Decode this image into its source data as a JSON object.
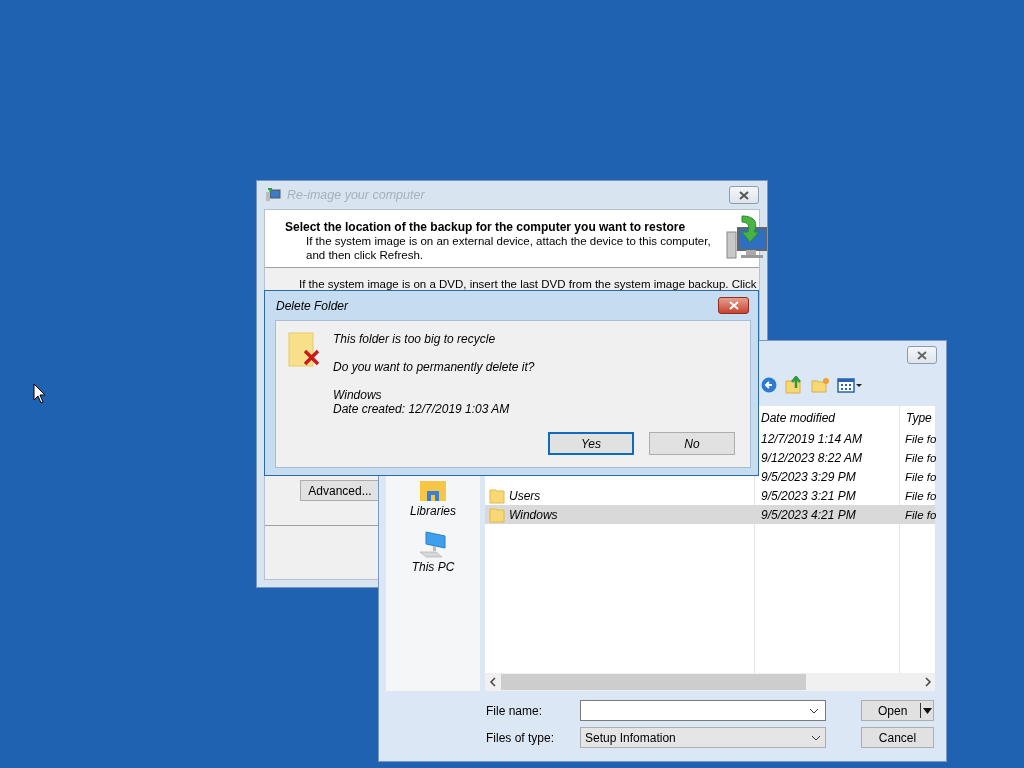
{
  "reimage_window": {
    "title": "Re-image your computer",
    "heading": "Select the location of the backup for the computer you want to restore",
    "subtext": "If the system image is on an external device, attach the device to this computer, and then click Refresh.",
    "body_text": "If the system image is on a DVD, insert the last DVD from the system image backup. Click",
    "advanced_button": "Advanced..."
  },
  "open_dialog": {
    "nav_items": [
      {
        "label": "Libraries",
        "kind": "libraries"
      },
      {
        "label": "This PC",
        "kind": "pc"
      }
    ],
    "columns": [
      "Date modified",
      "Type"
    ],
    "rows": [
      {
        "date": "12/7/2019 1:14 AM",
        "type": "File fo",
        "selected": false
      },
      {
        "date": "9/12/2023 8:22 AM",
        "type": "File fo",
        "selected": false
      },
      {
        "date": "9/5/2023 3:29 PM",
        "type": "File fo",
        "selected": false
      },
      {
        "name": "Users",
        "date": "9/5/2023 3:21 PM",
        "type": "File fo",
        "selected": false
      },
      {
        "name": "Windows",
        "date": "9/5/2023 4:21 PM",
        "type": "File fo",
        "selected": true
      }
    ],
    "file_name_label": "File name:",
    "file_type_label": "Files of type:",
    "file_type": "Setup Infomation",
    "open_button": "Open",
    "cancel_button": "Cancel"
  },
  "delete_dialog": {
    "title": "Delete Folder",
    "message": "This folder is too big to recycle",
    "question": "Do you want to permanently delete it?",
    "item_name": "Windows",
    "item_date": "Date created: 12/7/2019 1:03 AM",
    "buttons": [
      {
        "label": "Yes",
        "selected": true
      },
      {
        "label": "No",
        "selected": false
      }
    ]
  }
}
